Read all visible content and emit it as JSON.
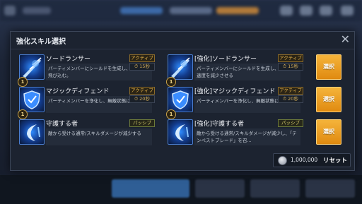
{
  "dialog": {
    "title": "強化スキル選択",
    "close": "✕"
  },
  "skills": [
    {
      "name": "ソードランサー",
      "type": "アクティブ",
      "cooldown": "15秒",
      "level": "1",
      "desc": "パーティメンバーにシールドを生成し、敵陣へと飛び込む。",
      "icon": "sword-dash-icon"
    },
    {
      "name": "[強化]ソードランサー",
      "type": "アクティブ",
      "cooldown": "15秒",
      "level": "1",
      "desc": "パーティメンバーにシールドを生成し、敵の攻撃速度を減少させる",
      "icon": "sword-dash-icon",
      "select": "選択"
    },
    {
      "name": "マジックディフェンド",
      "type": "アクティブ",
      "cooldown": "20秒",
      "level": "1",
      "desc": "パーティメンバーを浄化し、無敵状態にする。",
      "icon": "shield-icon"
    },
    {
      "name": "[強化]マジックディフェンド",
      "type": "アクティブ",
      "cooldown": "20秒",
      "level": "1",
      "desc": "パーティメンバーを浄化し、無敵状態にする。",
      "icon": "shield-icon",
      "select": "選択"
    },
    {
      "name": "守護する者",
      "type": "パッシブ",
      "level": "1",
      "desc": "敵から受ける通常/スキルダメージが減少する",
      "icon": "guardian-icon"
    },
    {
      "name": "[強化]守護する者",
      "type": "パッシブ",
      "level": "1",
      "desc": "敵から受ける通常/スキルダメージが減少し、「テンペストブレード」を召...",
      "icon": "guardian-icon",
      "select": "選択"
    }
  ],
  "reset": {
    "cost": "1,000,000",
    "label": "リセット",
    "icon": "silver-coin-icon"
  },
  "colors": {
    "accent": "#f0a020",
    "tag": "#e6b44a",
    "panel": "#1c2330"
  }
}
